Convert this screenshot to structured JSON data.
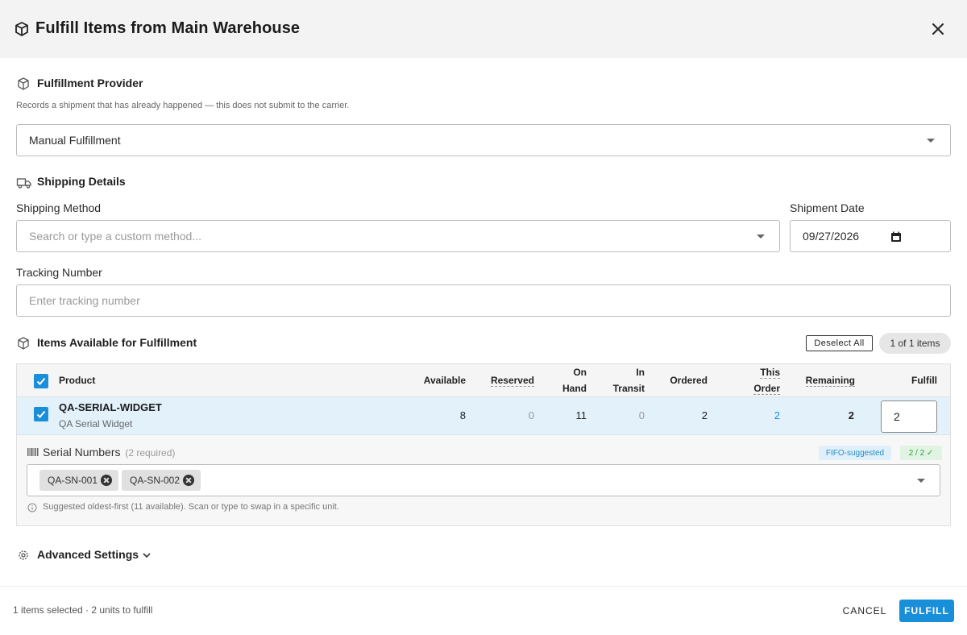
{
  "dialog": {
    "title": "Fulfill Items from Main Warehouse",
    "close_icon": "close-icon"
  },
  "provider": {
    "title": "Fulfillment Provider",
    "hint": "Records a shipment that has already happened — this does not submit to the carrier.",
    "selected": "Manual Fulfillment"
  },
  "shipping": {
    "title": "Shipping Details",
    "method_label": "Shipping Method",
    "method_placeholder": "Search or type a custom method...",
    "date_label": "Shipment Date",
    "date_value": "09/27/2026",
    "tracking_label": "Tracking Number",
    "tracking_placeholder": "Enter tracking number"
  },
  "items": {
    "title": "Items Available for Fulfillment",
    "deselect_label": "Deselect All",
    "count_label": "1 of 1 items",
    "columns": {
      "product": "Product",
      "available": "Available",
      "reserved": "Reserved",
      "on_hand_1": "On",
      "on_hand_2": "Hand",
      "in_transit_1": "In",
      "in_transit_2": "Transit",
      "ordered": "Ordered",
      "this_order_1": "This",
      "this_order_2": "Order",
      "remaining": "Remaining",
      "fulfill": "Fulfill"
    },
    "rows": [
      {
        "sku": "QA-SERIAL-WIDGET",
        "name": "QA Serial Widget",
        "available": "8",
        "reserved": "0",
        "on_hand": "11",
        "in_transit": "0",
        "ordered": "2",
        "this_order": "2",
        "remaining": "2",
        "fulfill": "2"
      }
    ],
    "serials": {
      "label": "Serial Numbers",
      "required": "(2 required)",
      "fifo_badge": "FIFO-suggested",
      "count_badge": "2 / 2 ✓",
      "chips": [
        "QA-SN-001",
        "QA-SN-002"
      ],
      "hint": "Suggested oldest-first (11 available). Scan or type to swap in a specific unit."
    }
  },
  "advanced": {
    "label": "Advanced Settings"
  },
  "footer": {
    "summary": "1 items selected · 2 units to fulfill",
    "cancel": "CANCEL",
    "fulfill": "FULFILL"
  },
  "colors": {
    "accent": "#1a8fd9",
    "row_selected": "#e3f1fb",
    "header_bg": "#f3f3f3"
  }
}
